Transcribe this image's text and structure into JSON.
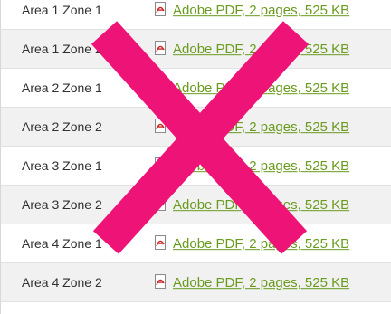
{
  "rows": [
    {
      "area": "Area 1 Zone 1",
      "link": "Adobe PDF, 2 pages, 525 KB"
    },
    {
      "area": "Area 1 Zone 2",
      "link": "Adobe PDF, 2 pages, 525 KB"
    },
    {
      "area": "Area 2 Zone 1",
      "link": "Adobe PDF, 2 pages, 525 KB"
    },
    {
      "area": "Area 2 Zone 2",
      "link": "Adobe PDF, 2 pages, 525 KB"
    },
    {
      "area": "Area 3 Zone 1",
      "link": "Adobe PDF, 2 pages, 525 KB"
    },
    {
      "area": "Area 3 Zone 2",
      "link": "Adobe PDF, 2 pages, 525 KB"
    },
    {
      "area": "Area 4 Zone 1",
      "link": "Adobe PDF, 2 pages, 525 KB"
    },
    {
      "area": "Area 4 Zone 2",
      "link": "Adobe PDF, 2 pages, 525 KB"
    }
  ],
  "icons": {
    "pdf": "pdf-file-icon",
    "overlay": "cross-mark-icon"
  },
  "colors": {
    "link": "#6a9b1e",
    "cross": "#ee1477",
    "stripe": "#f1f1f1",
    "pdf_icon": "#cc2222"
  }
}
